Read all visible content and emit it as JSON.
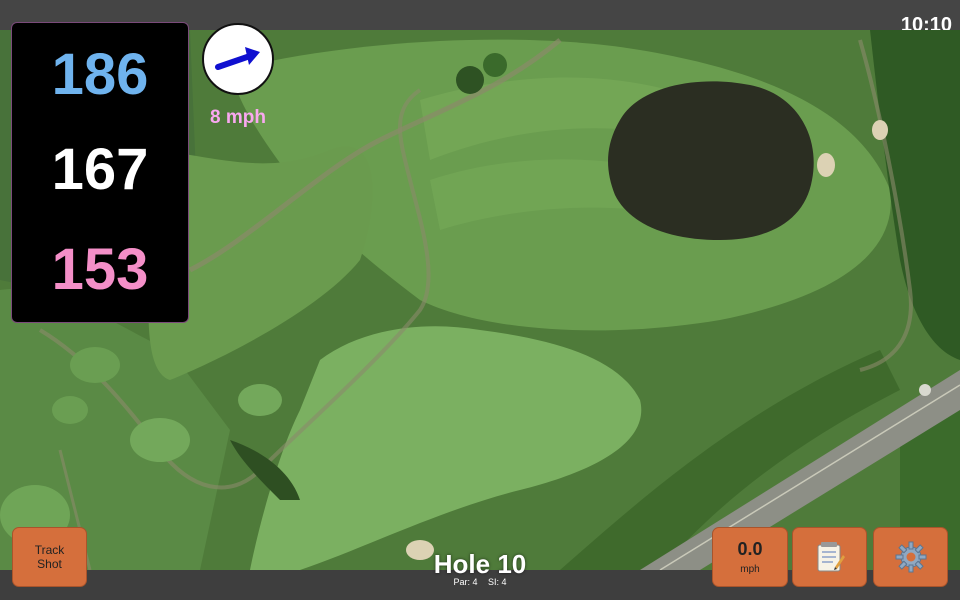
{
  "status_bar": {
    "time": "10:10"
  },
  "yardages": {
    "back": "186",
    "middle": "167",
    "front": "153"
  },
  "wind": {
    "speed_label": "8 mph",
    "direction_icon": "arrow-icon"
  },
  "buttons": {
    "track_shot_line1": "Track",
    "track_shot_line2": "Shot",
    "speed_value": "0.0",
    "speed_unit": "mph",
    "notes_icon": "notepad-icon",
    "settings_icon": "gear-icon"
  },
  "hole": {
    "title": "Hole 10",
    "par": "Par: 4",
    "si": "SI: 4"
  },
  "colors": {
    "back_yard": "#6fb3ee",
    "middle_yard": "#ffffff",
    "front_yard": "#f48fc8",
    "wind_label": "#f9a8f0",
    "button": "#d56f3c",
    "map_green": "#4e7a3a"
  }
}
